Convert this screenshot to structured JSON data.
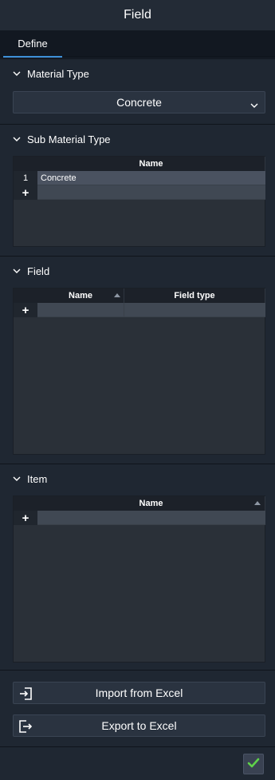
{
  "window": {
    "title": "Field"
  },
  "tabs": [
    {
      "label": "Define",
      "active": true
    }
  ],
  "accent_color": "#3d8fd6",
  "material_type": {
    "heading": "Material Type",
    "selected": "Concrete"
  },
  "sub_material_type": {
    "heading": "Sub Material Type",
    "columns": [
      "Name"
    ],
    "rows": [
      {
        "num": "1",
        "name": "Concrete"
      }
    ],
    "add_row_symbol": "+"
  },
  "field": {
    "heading": "Field",
    "columns": [
      "Name",
      "Field type"
    ],
    "add_row_symbol": "+"
  },
  "item": {
    "heading": "Item",
    "columns": [
      "Name"
    ],
    "add_row_symbol": "+"
  },
  "actions": {
    "import_label": "Import from Excel",
    "export_label": "Export to Excel",
    "import_icon": "import-icon",
    "export_icon": "export-icon"
  },
  "footer": {
    "ok_icon": "checkmark-icon",
    "ok_color": "#5fd14a"
  }
}
